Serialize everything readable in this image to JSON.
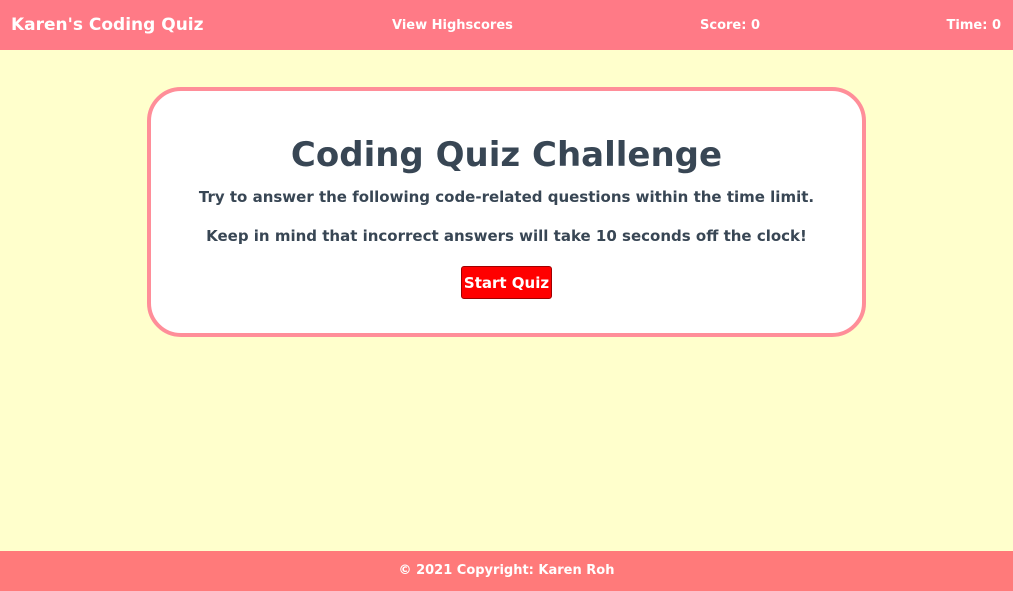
{
  "header": {
    "brand": "Karen's Coding Quiz",
    "highscores_link": "View Highscores",
    "score": "Score: 0",
    "time": "Time: 0"
  },
  "card": {
    "title": "Coding Quiz Challenge",
    "intro": "Try to answer the following code-related questions within the time limit.",
    "warning": "Keep in mind that incorrect answers will take 10 seconds off the clock!",
    "start_label": "Start Quiz"
  },
  "footer": {
    "copyright": "© 2021 Copyright: Karen Roh"
  },
  "colors": {
    "background": "#FFFFCC",
    "header": "#FF7A86",
    "card_border": "#FF8E99",
    "start_button": "#FF0000",
    "footer": "#FF7A7A",
    "text": "#384654"
  }
}
